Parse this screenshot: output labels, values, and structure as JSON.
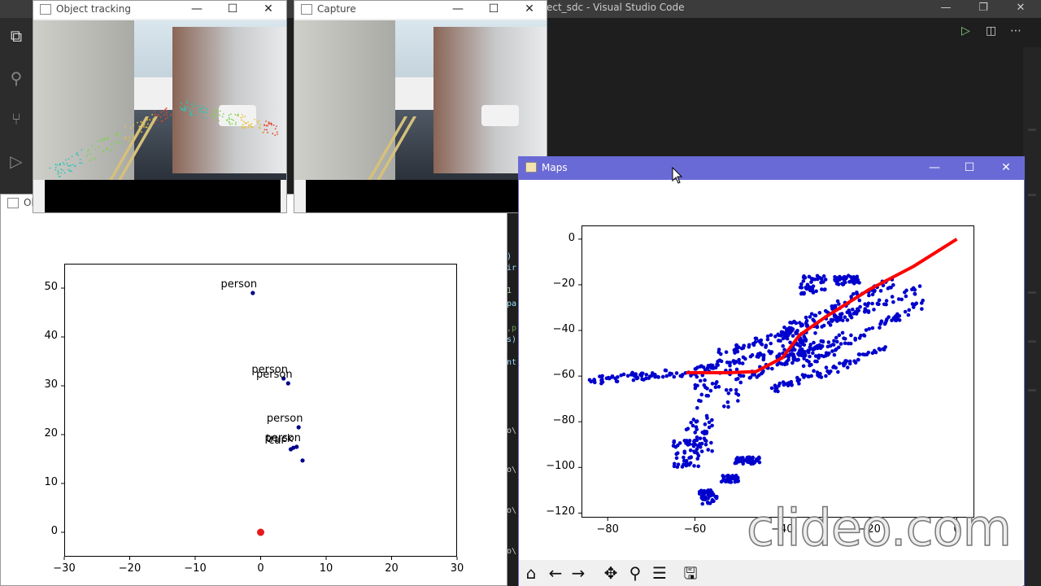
{
  "vscode": {
    "title": "ect_sdc - Visual Studio Code",
    "code_fragments": [
      ")",
      "ir",
      "1",
      "pa",
      ",p",
      "s)",
      "nt",
      "o\\",
      "o\\",
      "o\\",
      "o\\"
    ]
  },
  "windows": {
    "tracking": {
      "title": "Object tracking"
    },
    "capture": {
      "title": "Capture"
    },
    "plot": {
      "title": "Obj"
    },
    "maps": {
      "title": "Maps"
    }
  },
  "left_plot": {
    "chart_data": {
      "type": "scatter",
      "xlim": [
        -30,
        30
      ],
      "ylim": [
        -5,
        55
      ],
      "xticks": [
        "−30",
        "−20",
        "−10",
        "0",
        "10",
        "20",
        "30"
      ],
      "yticks": [
        "0",
        "10",
        "20",
        "30",
        "40",
        "50"
      ],
      "points": [
        {
          "x": -1.2,
          "y": 49,
          "label": "person"
        },
        {
          "x": 3.5,
          "y": 31.5,
          "label": "person"
        },
        {
          "x": 4.2,
          "y": 30.5,
          "label": "person"
        },
        {
          "x": 5.8,
          "y": 21.5,
          "label": "person"
        },
        {
          "x": 5.5,
          "y": 17.5,
          "label": "person"
        },
        {
          "x": 5.0,
          "y": 17.3,
          "label": "truck"
        },
        {
          "x": 4.6,
          "y": 17.0,
          "label": "car"
        },
        {
          "x": 6.4,
          "y": 14.7,
          "label": ""
        }
      ],
      "ego": {
        "x": 0,
        "y": 0
      },
      "colors": {
        "points": "#00008b",
        "ego": "#e41a1c"
      }
    }
  },
  "maps_plot": {
    "chart_data": {
      "type": "scatter",
      "xlim": [
        -86,
        4
      ],
      "ylim": [
        -122,
        6
      ],
      "xticks": [
        "−80",
        "−60",
        "−40",
        "−20",
        "0"
      ],
      "yticks": [
        "0",
        "−20",
        "−40",
        "−60",
        "−80",
        "−100",
        "−120"
      ],
      "trajectory": [
        [
          0,
          0
        ],
        [
          -10,
          -12
        ],
        [
          -20,
          -22
        ],
        [
          -30,
          -34
        ],
        [
          -36,
          -42
        ],
        [
          -40,
          -52
        ],
        [
          -46,
          -58
        ],
        [
          -52,
          -58.5
        ],
        [
          -62,
          -58.5
        ]
      ],
      "colors": {
        "trajectory": "#ff0000",
        "points": "#0000cd"
      }
    }
  },
  "maps_toolbar": [
    "home-icon",
    "back-icon",
    "forward-icon",
    "pan-icon",
    "zoom-icon",
    "configure-icon",
    "save-icon"
  ],
  "watermark": "clideo.com"
}
